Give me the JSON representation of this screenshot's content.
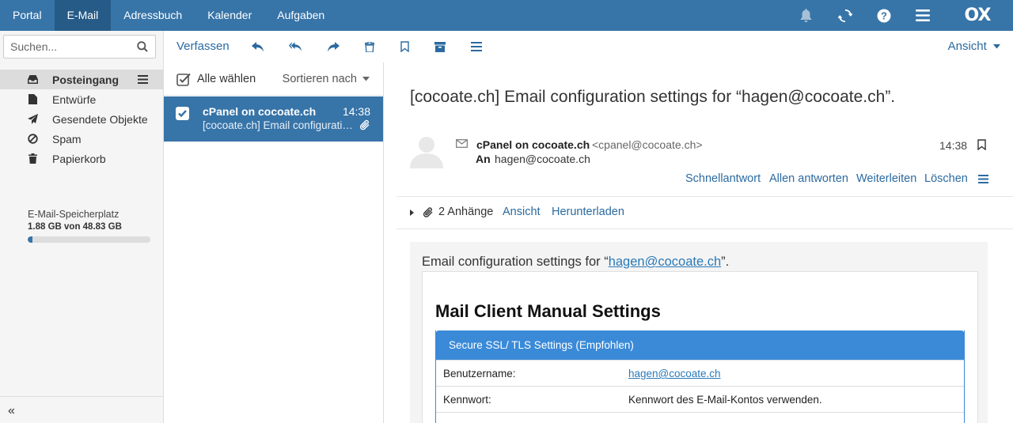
{
  "topnav": {
    "items": [
      "Portal",
      "E-Mail",
      "Adressbuch",
      "Kalender",
      "Aufgaben"
    ],
    "active": "E-Mail",
    "logo": "OX"
  },
  "sidebar": {
    "search_placeholder": "Suchen...",
    "folders": [
      {
        "label": "Posteingang",
        "icon": "inbox-icon",
        "active": true
      },
      {
        "label": "Entwürfe",
        "icon": "file-icon"
      },
      {
        "label": "Gesendete Objekte",
        "icon": "send-icon"
      },
      {
        "label": "Spam",
        "icon": "ban-icon"
      },
      {
        "label": "Papierkorb",
        "icon": "trash-icon"
      }
    ],
    "quota": {
      "title": "E-Mail-Speicherplatz",
      "value": "1.88 GB von 48.83 GB",
      "fraction": 0.0385
    },
    "collapse": "«"
  },
  "toolbar": {
    "compose": "Verfassen",
    "view": "Ansicht"
  },
  "list": {
    "select_all": "Alle wählen",
    "sort_by": "Sortieren nach",
    "items": [
      {
        "from": "cPanel on cocoate.ch",
        "time": "14:38",
        "subject": "[cocoate.ch] Email configuration settings for “hagen@cocoate.ch”.",
        "selected": true
      }
    ]
  },
  "detail": {
    "subject": "[cocoate.ch] Email configuration settings for “hagen@cocoate.ch”.",
    "from_name": "cPanel on cocoate.ch",
    "from_addr": "<cpanel@cocoate.ch>",
    "to_label": "An",
    "to": "hagen@cocoate.ch",
    "time": "14:38",
    "actions": [
      "Schnellantwort",
      "Allen antworten",
      "Weiterleiten",
      "Löschen"
    ],
    "attachments": {
      "count_label": "2 Anhänge",
      "view": "Ansicht",
      "download": "Herunterladen"
    }
  },
  "body": {
    "intro_prefix": "Email configuration settings for “",
    "intro_link": "hagen@cocoate.ch",
    "intro_suffix": "”.",
    "heading": "Mail Client Manual Settings",
    "table_header": "Secure SSL/ TLS Settings (Empfohlen)",
    "rows": [
      {
        "key": "Benutzername:",
        "value": "hagen@cocoate.ch",
        "link": true
      },
      {
        "key": "Kennwort:",
        "value": "Kennwort des E-Mail-Kontos verwenden.",
        "link": false
      }
    ]
  }
}
